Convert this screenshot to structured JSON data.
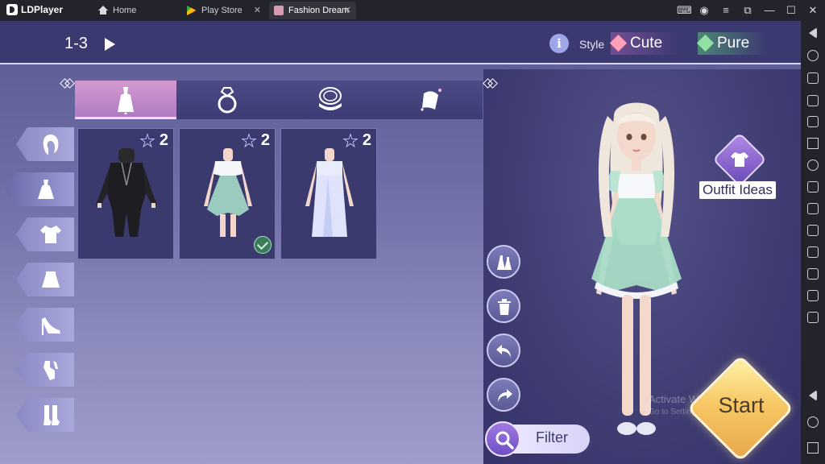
{
  "titlebar": {
    "app_name": "LDPlayer",
    "tabs": [
      {
        "label": "Home",
        "icon": "home-icon",
        "active": false
      },
      {
        "label": "Play Store",
        "icon": "play-store-icon",
        "active": false
      },
      {
        "label": "Fashion Dream",
        "icon": "fashion-dream-icon",
        "active": true
      }
    ],
    "controls": [
      "gamepad-icon",
      "account-icon",
      "menu-icon",
      "resize-icon",
      "minimize-icon",
      "maximize-icon",
      "close-icon"
    ]
  },
  "emulator_toolbar": {
    "buttons": [
      "collapse-icon",
      "settings-icon",
      "keyboard-icon",
      "volume-up-icon",
      "volume-down-icon",
      "fullscreen-icon",
      "sync-icon",
      "install-apk-icon",
      "apk-icon",
      "scissors-icon",
      "record-icon",
      "operations-icon",
      "shake-icon",
      "more-icon",
      "back-icon",
      "home-icon",
      "recents-icon"
    ]
  },
  "game": {
    "level": "1-3",
    "style_label": "Style",
    "styles": [
      {
        "label": "Cute",
        "color": "#ff9fb8"
      },
      {
        "label": "Pure",
        "color": "#8fe0a2"
      }
    ],
    "categories": [
      "dress-category-icon",
      "ring-category-icon",
      "compact-category-icon",
      "accessory-category-icon"
    ],
    "side_categories": [
      "hairstyle-icon",
      "dress-icon",
      "top-icon",
      "skirt-icon",
      "heels-icon",
      "gloves-icon",
      "socks-icon"
    ],
    "items": [
      {
        "name": "black-leather-outfit",
        "rank": "2",
        "selected": false
      },
      {
        "name": "mint-chiffon-dress",
        "rank": "2",
        "selected": true
      },
      {
        "name": "white-long-gown",
        "rank": "2",
        "selected": false
      }
    ],
    "actions": [
      "wardrobe-icon",
      "trash-icon",
      "undo-icon",
      "redo-icon"
    ],
    "filter_label": "Filter",
    "outfit_ideas_label": "Outfit Ideas",
    "start_label": "Start",
    "watermark_title": "Activate Windows",
    "watermark_sub": "Go to Settings to activate Windows."
  }
}
